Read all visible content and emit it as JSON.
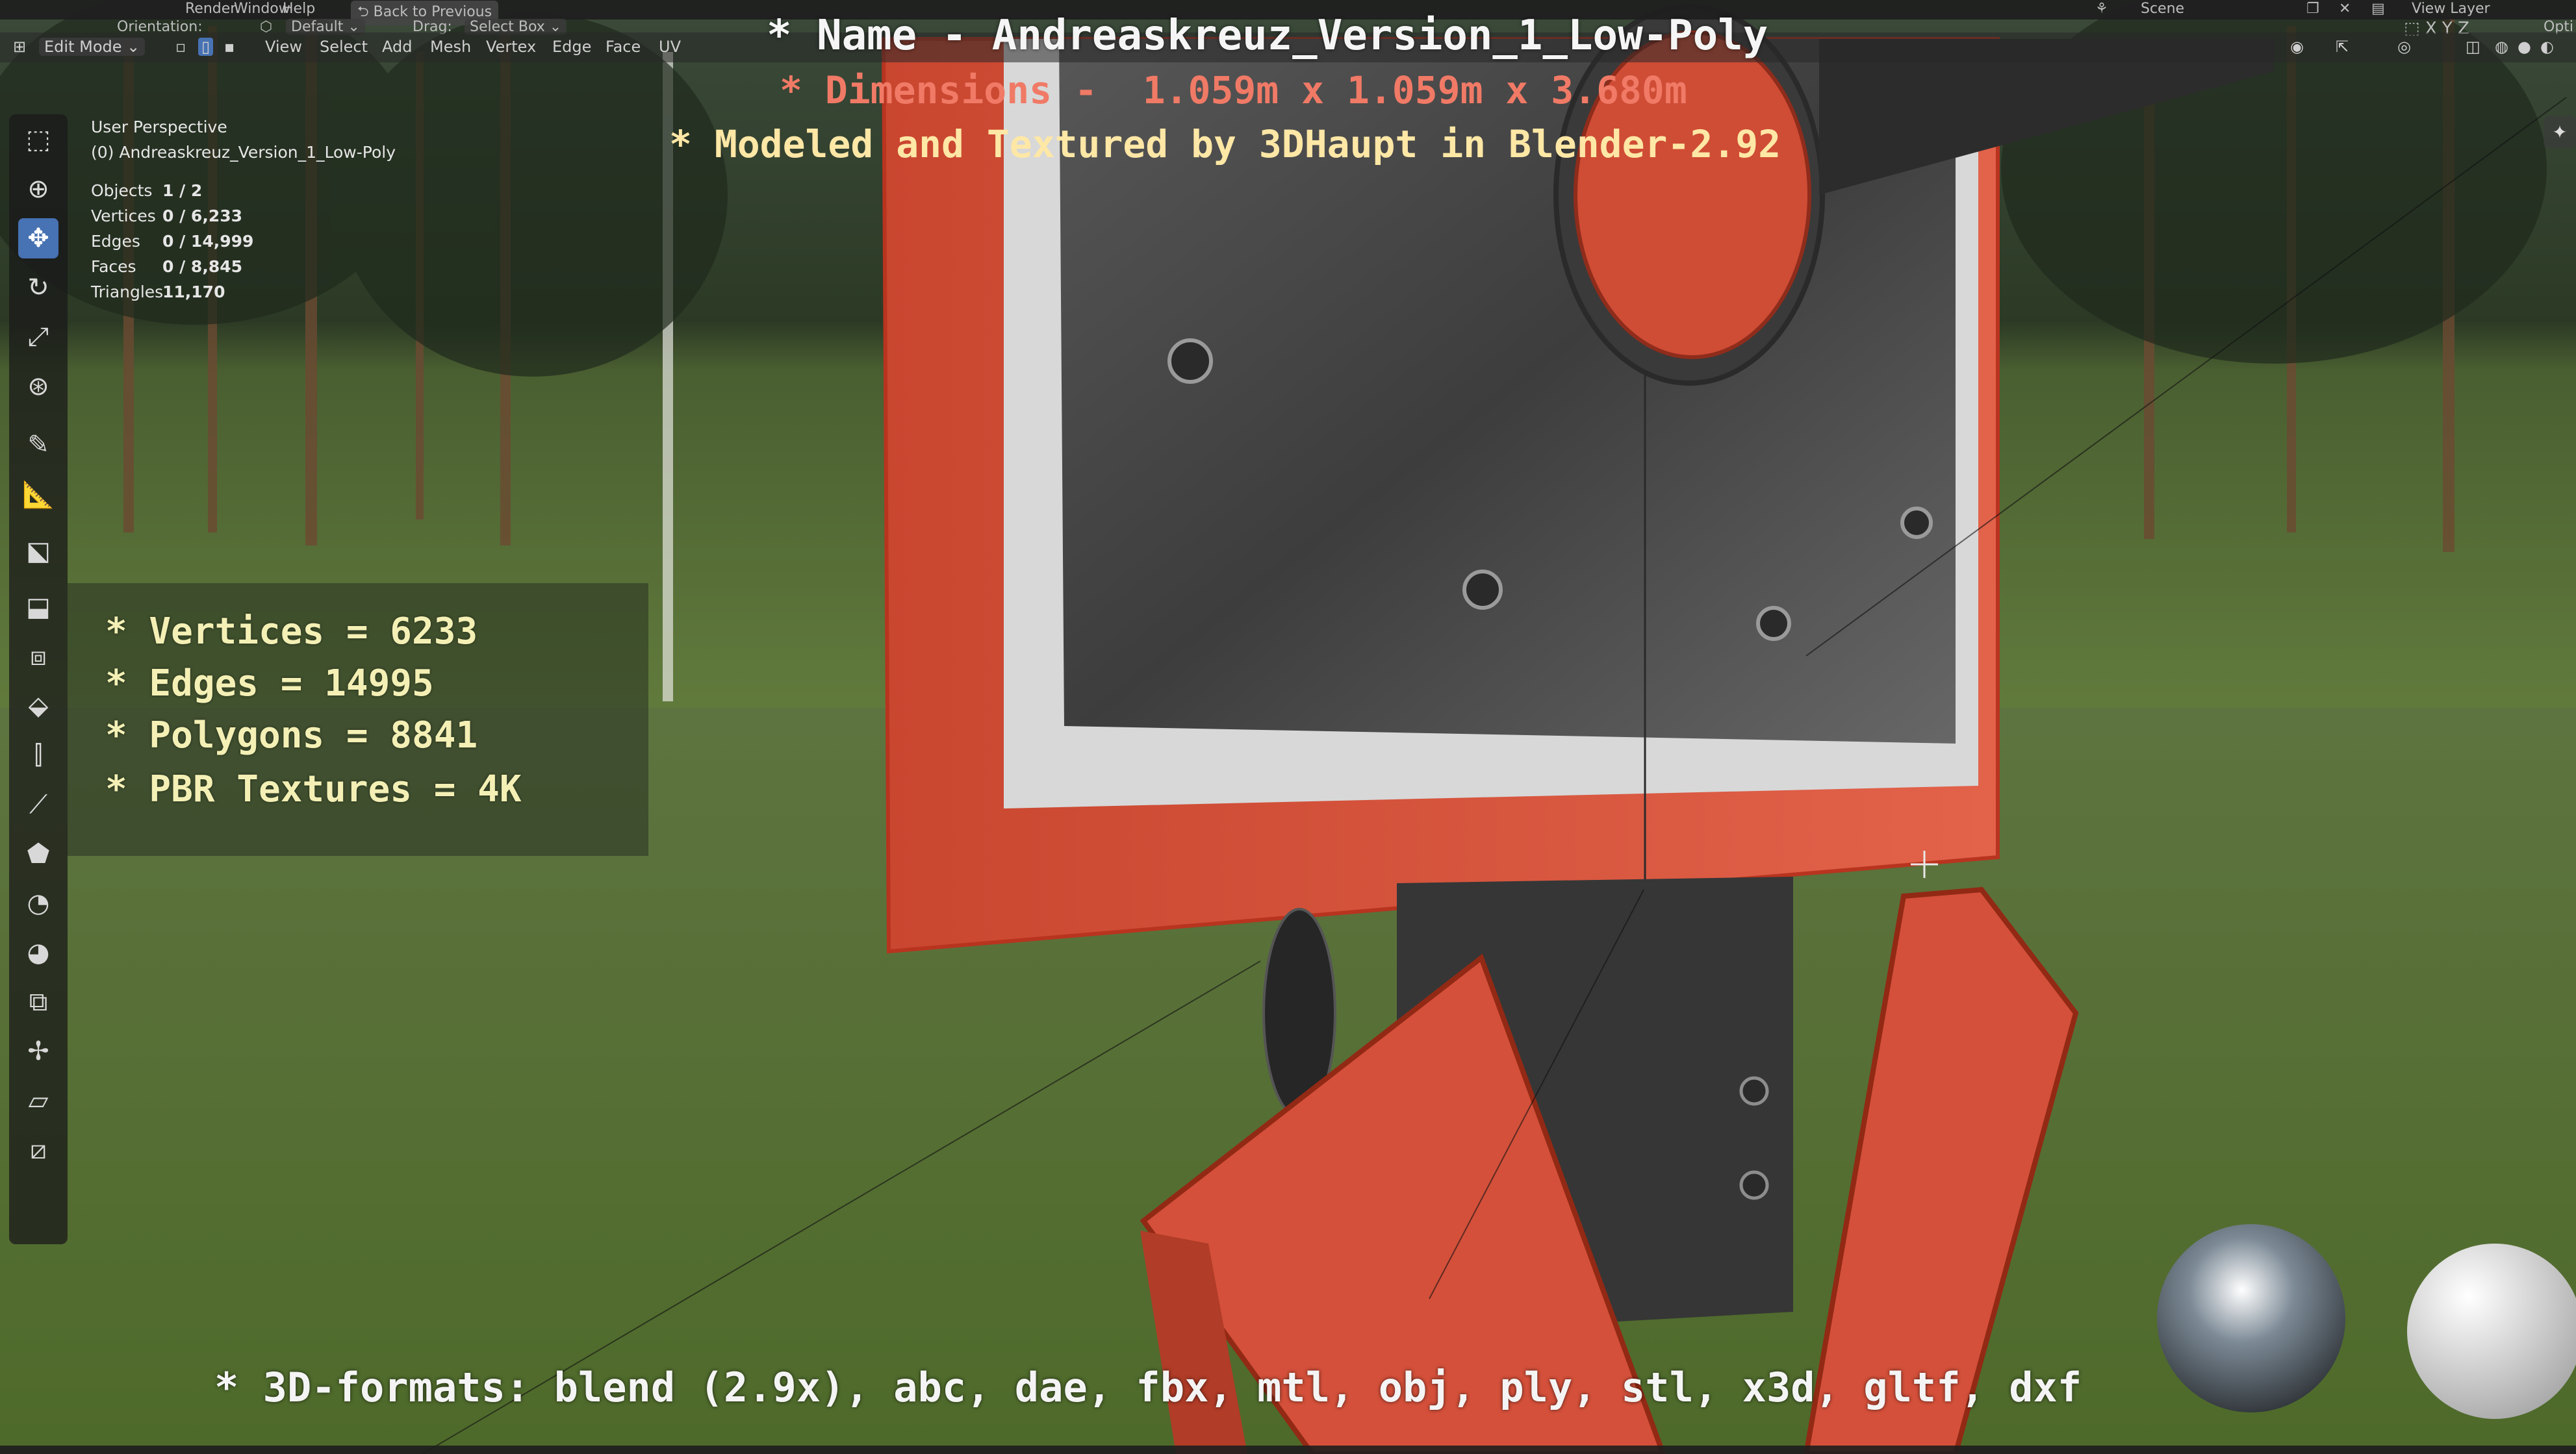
{
  "topbar": {
    "menu": [
      "Render",
      "Window",
      "Help"
    ],
    "back_button": "Back to Previous",
    "scene": "Scene",
    "view_layer": "View Layer",
    "options": "Opti"
  },
  "header": {
    "orientation_label": "Orientation:",
    "orientation_value": "Default",
    "drag_label": "Drag:",
    "drag_value": "Select Box"
  },
  "editor_header": {
    "mode": "Edit Mode",
    "menus": [
      "View",
      "Select",
      "Add",
      "Mesh",
      "Vertex",
      "Edge",
      "Face",
      "UV"
    ]
  },
  "viewport_info": {
    "view_name": "User Perspective",
    "object_name": "(0) Andreaskreuz_Version_1_Low-Poly",
    "stats": [
      {
        "label": "Objects",
        "value": "1 / 2"
      },
      {
        "label": "Vertices",
        "value": "0 / 6,233"
      },
      {
        "label": "Edges",
        "value": "0 / 14,999"
      },
      {
        "label": "Faces",
        "value": "0 / 8,845"
      },
      {
        "label": "Triangles",
        "value": "11,170"
      }
    ]
  },
  "overlay_text": {
    "line1": "* Name - Andreaskreuz_Version_1_Low-Poly",
    "line2": "* Dimensions -  1.059m x 1.059m x 3.680m",
    "line3": "* Modeled and Textured by 3DHaupt in Blender-2.92",
    "info": [
      "* Vertices = 6233",
      "* Edges = 14995",
      "* Polygons = 8841",
      "* PBR Textures = 4K"
    ],
    "formats": "* 3D-formats: blend (2.9x), abc, dae, fbx, mtl, obj, ply, stl, x3d, gltf, dxf"
  },
  "tools": [
    "select-box-icon",
    "cursor-icon",
    "move-icon",
    "rotate-icon",
    "scale-icon",
    "transform-icon",
    "annotate-icon",
    "measure-icon",
    "add-cube-icon",
    "extrude-icon",
    "inset-icon",
    "bevel-icon",
    "loop-cut-icon",
    "knife-icon",
    "poly-build-icon",
    "spin-icon",
    "smooth-icon",
    "edge-slide-icon",
    "shrink-fatten-icon",
    "shear-icon",
    "rip-icon"
  ],
  "colors": {
    "accent": "#4772b3",
    "sign_red": "#d9543d",
    "heading_red": "#f07a66",
    "heading_cream": "#ffe7a6",
    "info_yellow": "#f4f0b5"
  }
}
